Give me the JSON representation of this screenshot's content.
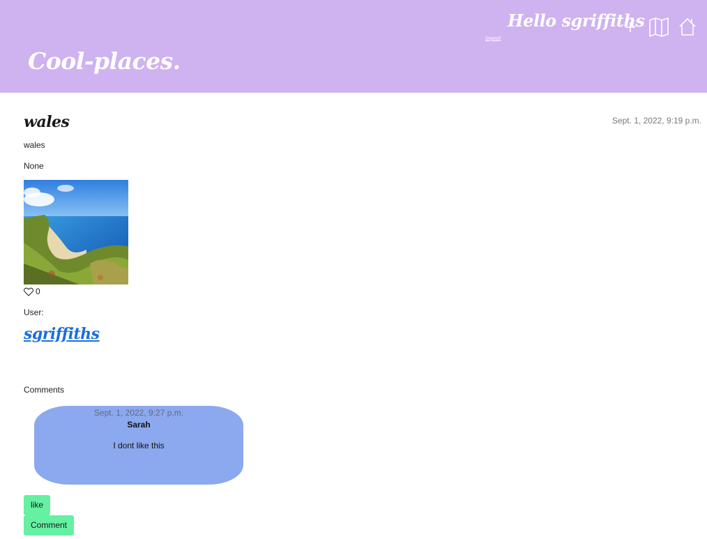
{
  "header": {
    "brand": "Cool-places.",
    "greeting": "Hello sgriffiths",
    "logout_label": "logout",
    "icons": [
      "plus-icon",
      "map-icon",
      "home-icon"
    ],
    "background": "#cfb2f0"
  },
  "post": {
    "title": "wales",
    "date": "Sept. 1, 2022, 9:19 p.m.",
    "location": "wales",
    "description": "None",
    "likes_count": "0",
    "user_label": "User:",
    "username": "sgriffiths"
  },
  "comments": {
    "heading": "Comments",
    "items": [
      {
        "date": "Sept. 1, 2022, 9:27 p.m.",
        "author": "Sarah",
        "text": "I dont like this"
      }
    ]
  },
  "actions": {
    "like_label": "like",
    "comment_label": "Comment"
  },
  "colors": {
    "accent_header": "#cfb2f0",
    "comment_bg": "#8ca8ee",
    "button_bg": "#66f0a2",
    "link": "#1a6ee0"
  }
}
